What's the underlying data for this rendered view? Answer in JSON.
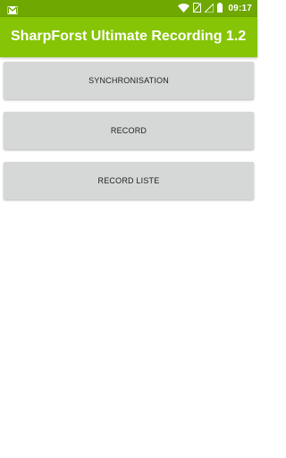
{
  "status_bar": {
    "time": "09:17",
    "icons": [
      "gmail-icon",
      "wifi-icon",
      "no-sim-icon",
      "signal-icon",
      "battery-icon"
    ],
    "background": "#6ea800"
  },
  "app_bar": {
    "title": "SharpForst Ultimate Recording 1.2",
    "background": "#86c406"
  },
  "buttons": {
    "synchronisation": "SYNCHRONISATION",
    "record": "RECORD",
    "record_liste": "RECORD LISTE",
    "background": "#d6d7d7"
  }
}
